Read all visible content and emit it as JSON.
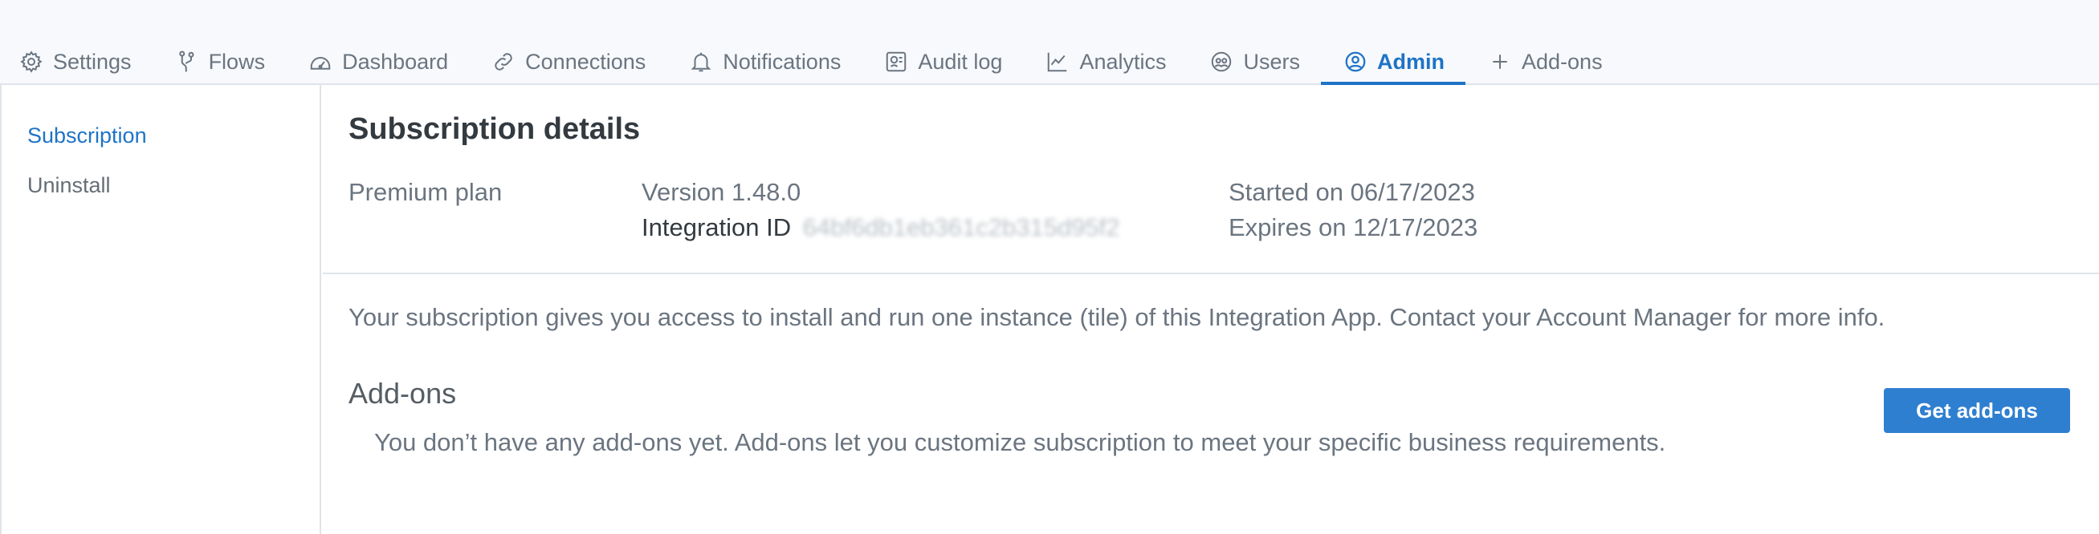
{
  "tabs": [
    {
      "label": "Settings",
      "icon": "gear-icon"
    },
    {
      "label": "Flows",
      "icon": "flow-icon"
    },
    {
      "label": "Dashboard",
      "icon": "dashboard-icon"
    },
    {
      "label": "Connections",
      "icon": "link-icon"
    },
    {
      "label": "Notifications",
      "icon": "bell-icon"
    },
    {
      "label": "Audit log",
      "icon": "audit-log-icon"
    },
    {
      "label": "Analytics",
      "icon": "chart-line-icon"
    },
    {
      "label": "Users",
      "icon": "users-icon"
    },
    {
      "label": "Admin",
      "icon": "user-circle-icon",
      "active": true
    },
    {
      "label": "Add-ons",
      "icon": "plus-icon"
    }
  ],
  "sidebar": {
    "items": [
      {
        "label": "Subscription",
        "active": true
      },
      {
        "label": "Uninstall"
      }
    ]
  },
  "subscription": {
    "title": "Subscription details",
    "plan": "Premium plan",
    "version": "Version 1.48.0",
    "integration_label": "Integration ID",
    "integration_id": "64bf6db1eb361c2b315d95f2",
    "started": "Started on 06/17/2023",
    "expires": "Expires on 12/17/2023",
    "info": "Your subscription gives you access to install and run one instance (tile) of this Integration App. Contact your Account Manager for more info."
  },
  "addons": {
    "title": "Add-ons",
    "description": "You don’t have any add-ons yet. Add-ons let you customize subscription to meet your specific business requirements.",
    "button_label": "Get add-ons"
  },
  "colors": {
    "accent": "#1e73c6",
    "button": "#2f7fd0",
    "header_bg": "#f7f9fc"
  }
}
